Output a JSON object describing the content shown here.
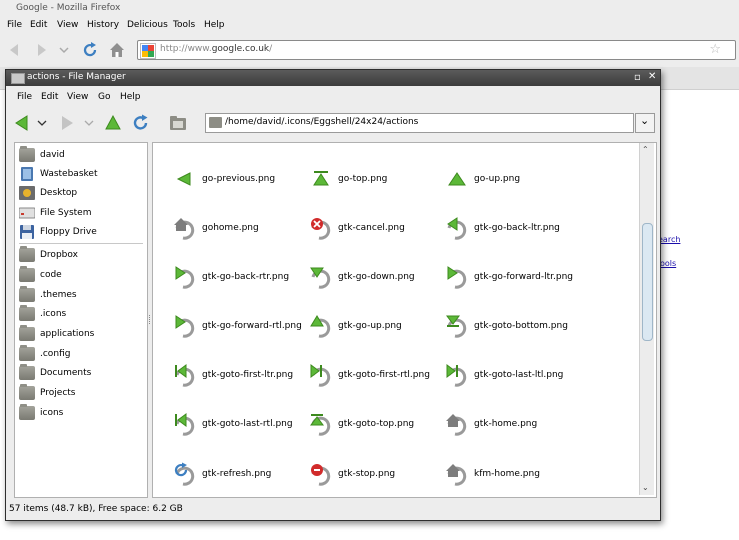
{
  "firefox": {
    "title": "Google - Mozilla Firefox",
    "menu": [
      "File",
      "Edit",
      "View",
      "History",
      "Delicious",
      "Tools",
      "Help"
    ],
    "url_prefix": "http://www.",
    "url_domain": "google.co.uk",
    "url_suffix": "/",
    "links": [
      "earch",
      "ools"
    ]
  },
  "fm": {
    "title": "actions - File Manager",
    "menu": [
      "File",
      "Edit",
      "View",
      "Go",
      "Help"
    ],
    "location": "/home/david/.icons/Eggshell/24x24/actions",
    "sidebar": [
      {
        "label": "david",
        "icon": "home-folder-icon"
      },
      {
        "label": "Wastebasket",
        "icon": "trash-icon"
      },
      {
        "label": "Desktop",
        "icon": "desktop-icon"
      },
      {
        "label": "File System",
        "icon": "hard-drive-icon"
      },
      {
        "label": "Floppy Drive",
        "icon": "floppy-icon"
      },
      {
        "label": "Dropbox",
        "icon": "folder-icon"
      },
      {
        "label": "code",
        "icon": "folder-icon"
      },
      {
        "label": ".themes",
        "icon": "folder-icon"
      },
      {
        "label": ".icons",
        "icon": "folder-icon"
      },
      {
        "label": "applications",
        "icon": "folder-icon"
      },
      {
        "label": ".config",
        "icon": "folder-icon"
      },
      {
        "label": "Documents",
        "icon": "folder-icon"
      },
      {
        "label": "Projects",
        "icon": "folder-icon"
      },
      {
        "label": "icons",
        "icon": "folder-icon"
      }
    ],
    "files": [
      {
        "name": "go-previous.png",
        "icon": "arrow-left-icon"
      },
      {
        "name": "go-top.png",
        "icon": "arrow-top-icon"
      },
      {
        "name": "go-up.png",
        "icon": "arrow-up-icon"
      },
      {
        "name": "gohome.png",
        "icon": "home-icon"
      },
      {
        "name": "gtk-cancel.png",
        "icon": "cancel-icon"
      },
      {
        "name": "gtk-go-back-ltr.png",
        "icon": "undo-left-icon"
      },
      {
        "name": "gtk-go-back-rtr.png",
        "icon": "undo-right-icon"
      },
      {
        "name": "gtk-go-down.png",
        "icon": "undo-down-icon"
      },
      {
        "name": "gtk-go-forward-ltr.png",
        "icon": "undo-right-icon"
      },
      {
        "name": "gtk-go-forward-rtl.png",
        "icon": "undo-right-icon"
      },
      {
        "name": "gtk-go-up.png",
        "icon": "undo-up-icon"
      },
      {
        "name": "gtk-goto-bottom.png",
        "icon": "undo-bottom-icon"
      },
      {
        "name": "gtk-goto-first-ltr.png",
        "icon": "undo-first-icon"
      },
      {
        "name": "gtk-goto-first-rtl.png",
        "icon": "undo-last-icon"
      },
      {
        "name": "gtk-goto-last-ltl.png",
        "icon": "undo-last-icon"
      },
      {
        "name": "gtk-goto-last-rtl.png",
        "icon": "undo-first-icon"
      },
      {
        "name": "gtk-goto-top.png",
        "icon": "undo-top-icon"
      },
      {
        "name": "gtk-home.png",
        "icon": "home-icon"
      },
      {
        "name": "gtk-refresh.png",
        "icon": "refresh-icon"
      },
      {
        "name": "gtk-stop.png",
        "icon": "stop-icon"
      },
      {
        "name": "kfm-home.png",
        "icon": "home-icon"
      }
    ],
    "status": "57 items (48.7 kB), Free space: 6.2 GB"
  }
}
